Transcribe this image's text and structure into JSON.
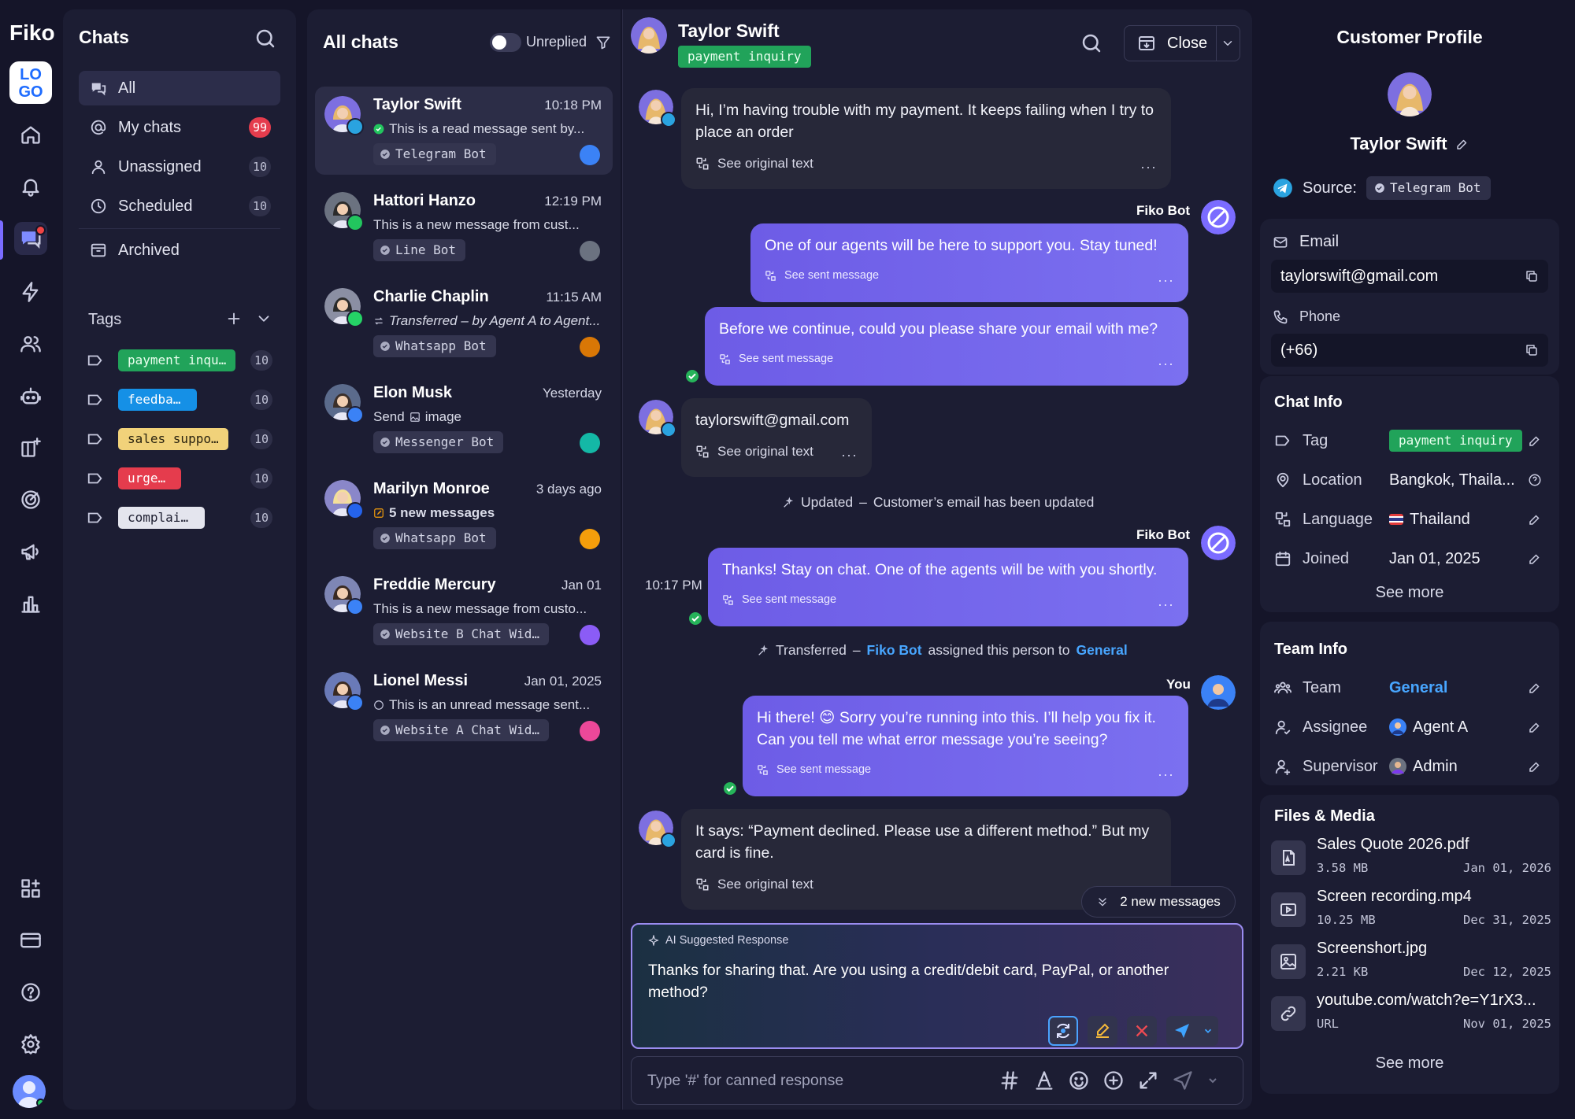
{
  "brand": {
    "name": "Fiko",
    "logo_text": "LOGO"
  },
  "sidebar": {
    "title": "Chats",
    "items": [
      {
        "label": "All",
        "count": ""
      },
      {
        "label": "My chats",
        "count": "99"
      },
      {
        "label": "Unassigned",
        "count": "10"
      },
      {
        "label": "Scheduled",
        "count": "10"
      },
      {
        "label": "Archived",
        "count": ""
      }
    ],
    "tags_title": "Tags",
    "tags": [
      {
        "label": "payment inqu…",
        "count": "10",
        "color": "#21a35a",
        "text": "#eaffef"
      },
      {
        "label": "feedback",
        "count": "10",
        "color": "#1590e6",
        "text": "#ffffff"
      },
      {
        "label": "sales support",
        "count": "10",
        "color": "#f1d27a",
        "text": "#2b2410"
      },
      {
        "label": "urgent",
        "count": "10",
        "color": "#e53c4d",
        "text": "#ffffff"
      },
      {
        "label": "complaint",
        "count": "10",
        "color": "#e4e5ee",
        "text": "#1d1e30"
      }
    ]
  },
  "chat_list": {
    "title": "All chats",
    "filter_label": "Unreplied",
    "items": [
      {
        "name": "Taylor Swift",
        "time": "10:18 PM",
        "preview": "This is a read message sent by...",
        "source": "Telegram Bot",
        "badge_color": "#2aa3e0"
      },
      {
        "name": "Hattori Hanzo",
        "time": "12:19 PM",
        "preview": "This is a new message from cust...",
        "source": "Line Bot",
        "badge_color": "#22c55e"
      },
      {
        "name": "Charlie Chaplin",
        "time": "11:15 AM",
        "preview": "Transferred – by Agent A to Agent...",
        "source": "Whatsapp Bot",
        "badge_color": "#25d366"
      },
      {
        "name": "Elon Musk",
        "time": "Yesterday",
        "preview_prefix": "Send",
        "preview": "image",
        "source": "Messenger Bot",
        "badge_color": "#3b82f6"
      },
      {
        "name": "Marilyn Monroe",
        "time": "3 days ago",
        "preview": "5 new messages",
        "source": "Whatsapp Bot",
        "badge_color": "#2563eb"
      },
      {
        "name": "Freddie Mercury",
        "time": "Jan 01",
        "preview": "This is a new message from custo...",
        "source": "Website B Chat Wid…",
        "badge_color": "#3b82f6"
      },
      {
        "name": "Lionel Messi",
        "time": "Jan 01, 2025",
        "preview": "This is an unread message sent...",
        "source": "Website A Chat Wid…",
        "badge_color": "#3b82f6"
      }
    ]
  },
  "conversation": {
    "header_name": "Taylor Swift",
    "header_tag": "payment inquiry",
    "close_label": "Close",
    "messages": [
      {
        "text": "Hi, I’m having trouble with my payment. It keeps failing when I try to place an order",
        "action": "See original text"
      },
      {
        "sender": "Fiko Bot",
        "text": "One of our agents will be here to support you. Stay tuned!",
        "action": "See sent message"
      },
      {
        "text": "Before we continue, could you please share your email with me?",
        "action": "See sent message"
      },
      {
        "text": "taylorswift@gmail.com",
        "action": "See original text"
      },
      {
        "sender": "Fiko Bot",
        "text": "Thanks! Stay on chat. One of the agents will be with you shortly.",
        "action": "See sent message",
        "time": "10:17 PM"
      },
      {
        "sender": "You",
        "text": "Hi there! 😊 Sorry you’re running into this. I’ll help you fix it. Can you tell me what error message you’re seeing?",
        "action": "See sent message"
      },
      {
        "text": "It says: “Payment declined. Please use a different method.” But my card is fine.",
        "action": "See original text"
      }
    ],
    "system_updated": {
      "label": "Updated",
      "text": "Customer’s email  has been updated"
    },
    "system_transferred": {
      "label": "Transferred",
      "actor": "Fiko Bot",
      "middle": "assigned this person to",
      "target": "General"
    },
    "new_messages": "2 new messages",
    "ai": {
      "label": "AI Suggested Response",
      "text": "Thanks for sharing that. Are you using a credit/debit card, PayPal, or another method?"
    },
    "composer_placeholder": "Type '#' for canned response"
  },
  "profile": {
    "title": "Customer Profile",
    "name": "Taylor Swift",
    "source_label": "Source:",
    "source": "Telegram Bot",
    "email_label": "Email",
    "email": "taylorswift@gmail.com",
    "phone_label": "Phone",
    "phone": "(+66)",
    "chat_info": {
      "title": "Chat Info",
      "tag_label": "Tag",
      "tag": "payment inquiry",
      "location_label": "Location",
      "location": "Bangkok, Thaila...",
      "language_label": "Language",
      "language": "Thailand",
      "joined_label": "Joined",
      "joined": "Jan 01, 2025",
      "see_more": "See more"
    },
    "team_info": {
      "title": "Team Info",
      "team_label": "Team",
      "team": "General",
      "assignee_label": "Assignee",
      "assignee": "Agent A",
      "supervisor_label": "Supervisor",
      "supervisor": "Admin"
    },
    "files": {
      "title": "Files & Media",
      "items": [
        {
          "name": "Sales Quote 2026.pdf",
          "size": "3.58 MB",
          "date": "Jan 01, 2026",
          "icon": "pdf-file-icon"
        },
        {
          "name": "Screen recording.mp4",
          "size": "10.25 MB",
          "date": "Dec 31, 2025",
          "icon": "video-file-icon"
        },
        {
          "name": "Screenshort.jpg",
          "size": "2.21 KB",
          "date": "Dec 12, 2025",
          "icon": "image-file-icon"
        },
        {
          "name": "youtube.com/watch?e=Y1rX3...",
          "size": "URL",
          "date": "Nov 01, 2025",
          "icon": "link-icon"
        }
      ],
      "see_more": "See more"
    }
  },
  "colors": {
    "accent": "#7b6cff",
    "bubble_out": "#6d5ce6",
    "tag_green": "#21a35a",
    "link": "#48a6ff"
  }
}
